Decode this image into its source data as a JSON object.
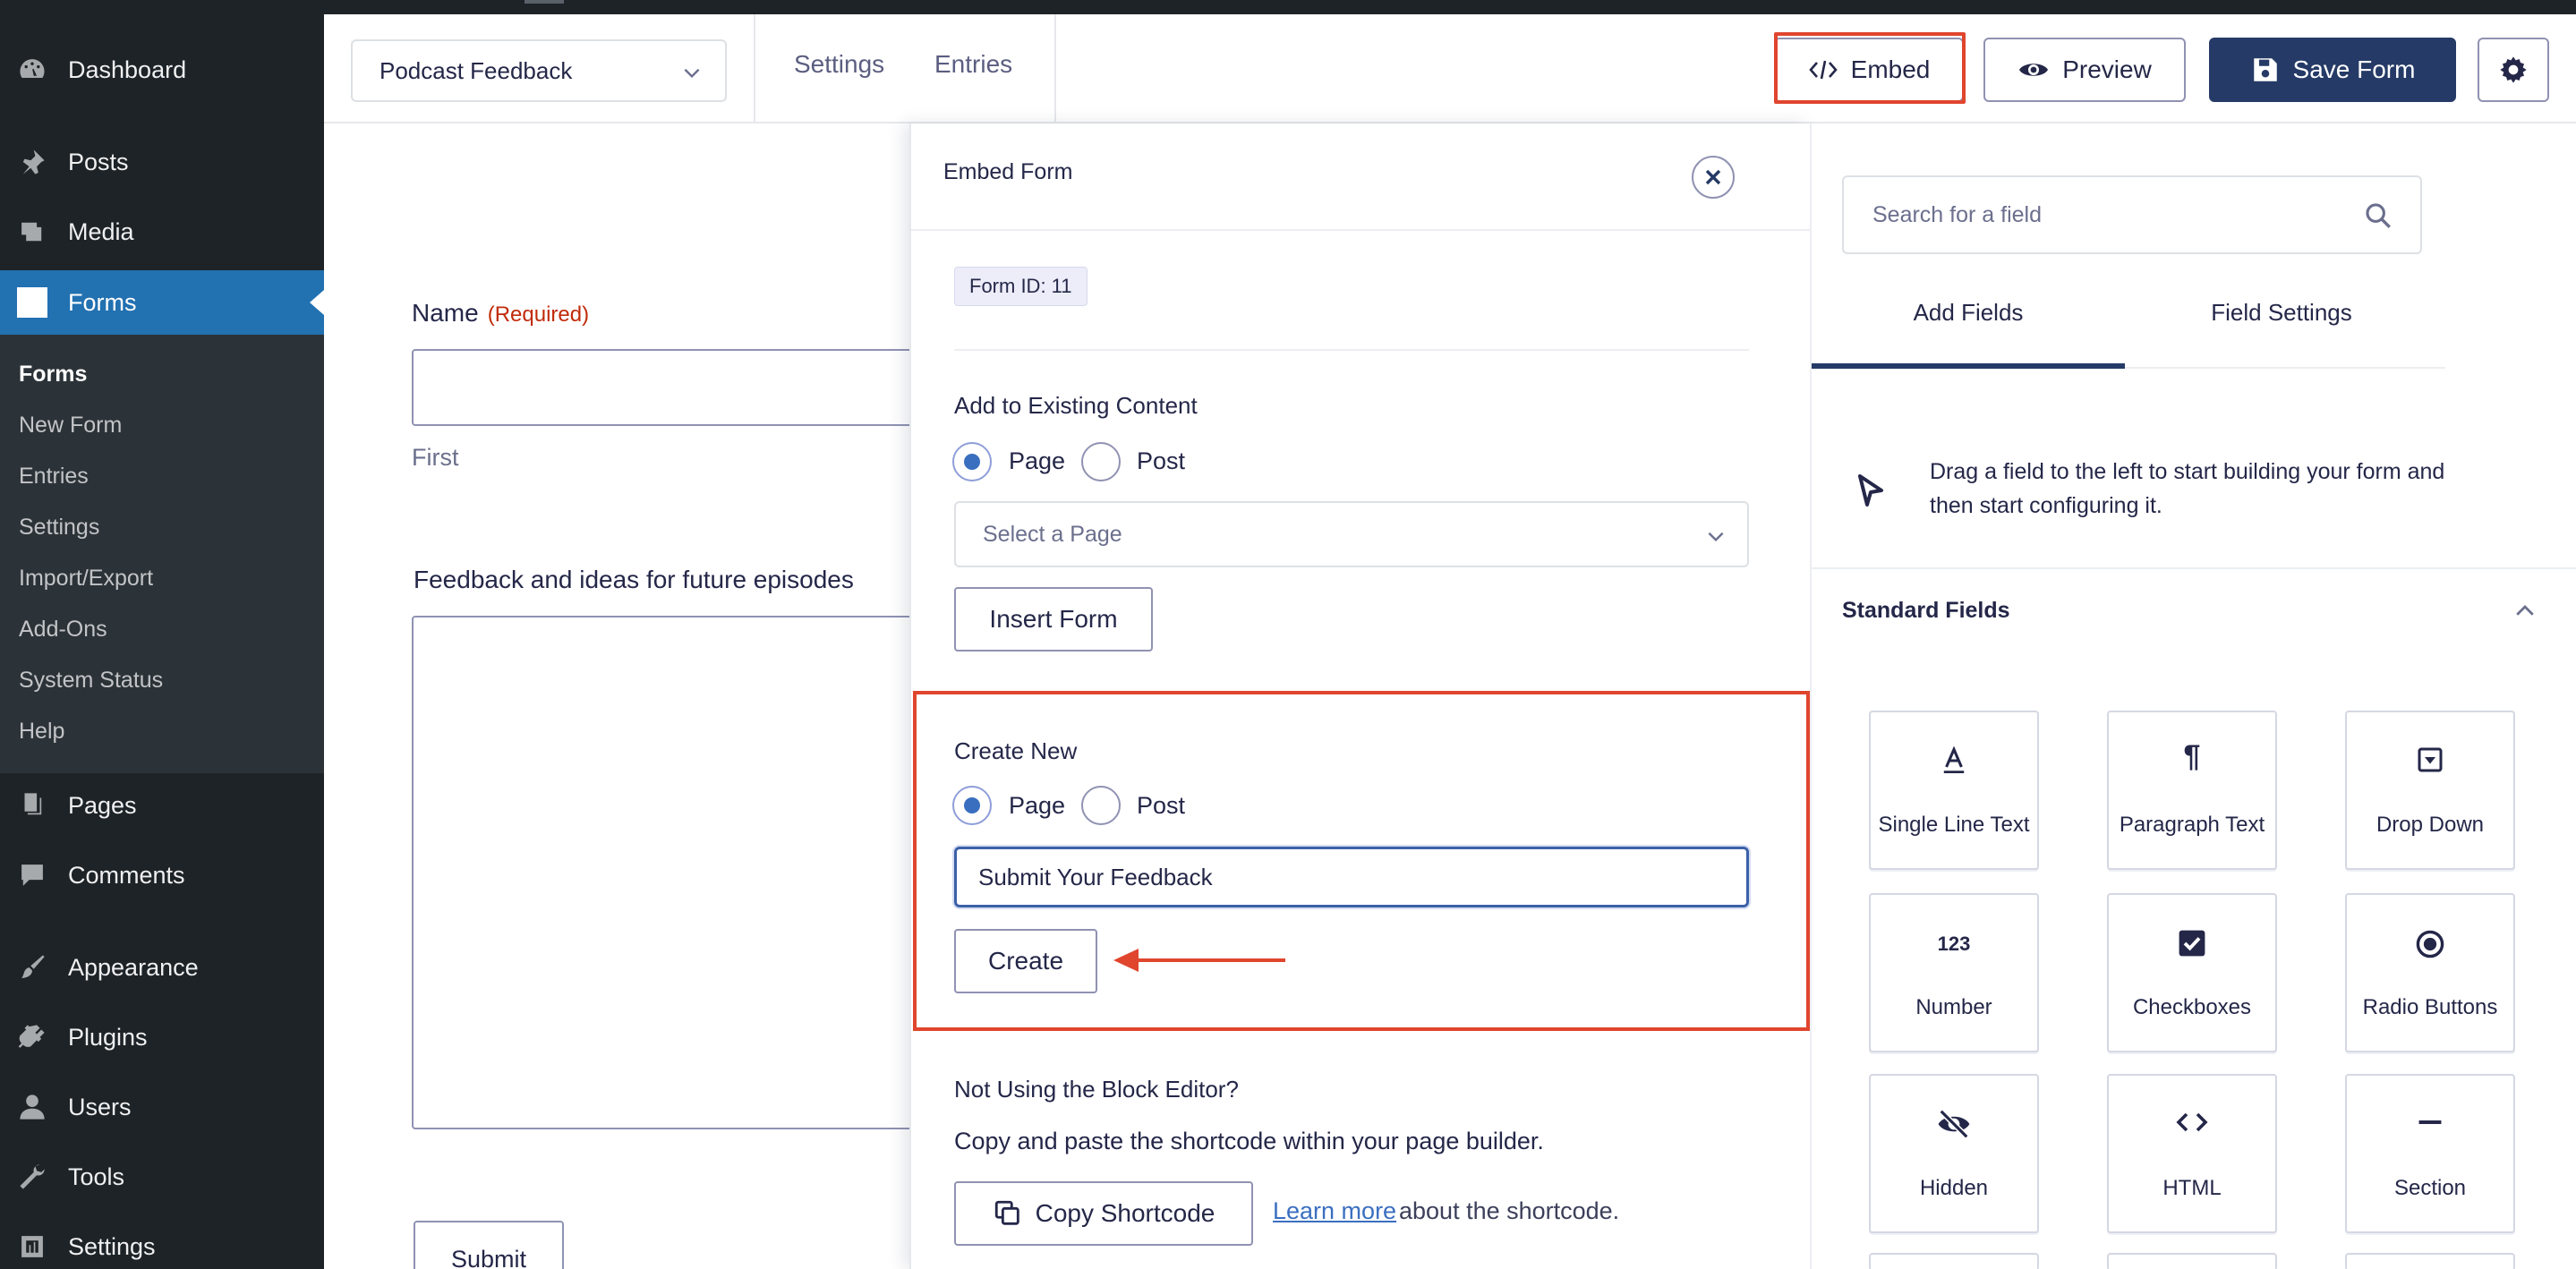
{
  "sidebar": {
    "items": [
      {
        "label": "Dashboard",
        "icon": "dashboard-icon"
      },
      {
        "label": "Posts",
        "icon": "pin-icon"
      },
      {
        "label": "Media",
        "icon": "media-icon"
      },
      {
        "label": "Forms",
        "icon": "forms-icon"
      },
      {
        "label": "Pages",
        "icon": "pages-icon"
      },
      {
        "label": "Comments",
        "icon": "comment-icon"
      },
      {
        "label": "Appearance",
        "icon": "brush-icon"
      },
      {
        "label": "Plugins",
        "icon": "plug-icon"
      },
      {
        "label": "Users",
        "icon": "user-icon"
      },
      {
        "label": "Tools",
        "icon": "wrench-icon"
      },
      {
        "label": "Settings",
        "icon": "settings-icon"
      }
    ],
    "submenu": [
      "Forms",
      "New Form",
      "Entries",
      "Settings",
      "Import/Export",
      "Add-Ons",
      "System Status",
      "Help"
    ]
  },
  "toolbar": {
    "form_name": "Podcast Feedback",
    "links": [
      "Settings",
      "Entries"
    ],
    "embed_label": "Embed",
    "preview_label": "Preview",
    "save_label": "Save Form"
  },
  "canvas": {
    "name_label": "Name",
    "required_label": "(Required)",
    "first_sublabel": "First",
    "feedback_label": "Feedback and ideas for future episodes",
    "submit_label": "Submit"
  },
  "embed": {
    "title": "Embed Form",
    "form_id": "Form ID: 11",
    "existing_heading": "Add to Existing Content",
    "page_label": "Page",
    "post_label": "Post",
    "page_select_placeholder": "Select a Page",
    "insert_label": "Insert Form",
    "create_heading": "Create New",
    "new_title_value": "Submit Your Feedback",
    "create_label": "Create",
    "not_block_heading": "Not Using the Block Editor?",
    "copy_hint": "Copy and paste the shortcode within your page builder.",
    "copy_label": "Copy Shortcode",
    "learn_more": "Learn more",
    "learn_tail": "about the shortcode."
  },
  "fields": {
    "search_placeholder": "Search for a field",
    "tabs": [
      "Add Fields",
      "Field Settings"
    ],
    "hint": "Drag a field to the left to start building your form and then start configuring it.",
    "standard_title": "Standard Fields",
    "items": [
      {
        "label": "Single Line Text",
        "icon": "text-icon"
      },
      {
        "label": "Paragraph Text",
        "icon": "paragraph-icon"
      },
      {
        "label": "Drop Down",
        "icon": "dropdown-icon"
      },
      {
        "label": "Number",
        "icon": "number-icon"
      },
      {
        "label": "Checkboxes",
        "icon": "checkbox-icon"
      },
      {
        "label": "Radio Buttons",
        "icon": "radio-icon"
      },
      {
        "label": "Hidden",
        "icon": "hidden-icon"
      },
      {
        "label": "HTML",
        "icon": "code-icon"
      },
      {
        "label": "Section",
        "icon": "section-icon"
      }
    ],
    "number_glyph": "123",
    "paragraph_glyph": "¶"
  },
  "colors": {
    "sidebar_bg": "#1d2327",
    "active_menu": "#2271b1",
    "save_button": "#253a66",
    "highlight": "#e0452e",
    "radio_checked": "#3a6fc0"
  }
}
